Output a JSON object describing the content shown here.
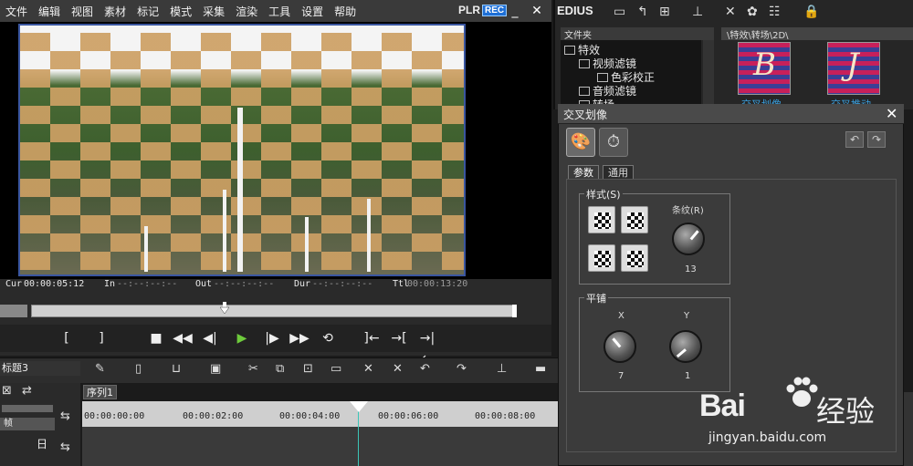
{
  "menubar": {
    "items": [
      "文件",
      "编辑",
      "视图",
      "素材",
      "标记",
      "模式",
      "采集",
      "渲染",
      "工具",
      "设置",
      "帮助"
    ],
    "plr": "PLR",
    "rec": "REC",
    "minimize": "_",
    "close": "✕"
  },
  "timecodes": {
    "cur_label": "Cur",
    "cur_val": "00:00:05:12",
    "in_label": "In",
    "in_val": "--:--:--:--",
    "out_label": "Out",
    "out_val": "--:--:--:--",
    "dur_label": "Dur",
    "dur_val": "--:--:--:--",
    "ttl_label": "Ttl",
    "ttl_val": "00:00:13:20"
  },
  "transport": {
    "mark_in": "[",
    "mark_out": "]",
    "stop": "■",
    "rewind": "◀◀",
    "step_back": "◀|",
    "play": "▶",
    "step_fwd": "|▶",
    "fast_fwd": "▶▶",
    "loop": "⟲",
    "insert": "]←",
    "overwrite": "→[",
    "replace": "→|←"
  },
  "bin": {
    "title": "EDIUS",
    "folder_header": "文件夹",
    "path": "\\特效\\转场\\2D\\",
    "tree": [
      {
        "label": "特效",
        "indent": 0
      },
      {
        "label": "视频滤镜",
        "indent": 1
      },
      {
        "label": "色彩校正",
        "indent": 2
      },
      {
        "label": "音频滤镜",
        "indent": 1
      },
      {
        "label": "转场",
        "indent": 1
      }
    ],
    "thumbnails": [
      {
        "letter": "B",
        "caption": "交叉划像"
      },
      {
        "letter": "J",
        "caption": "交叉推动"
      }
    ]
  },
  "dialog": {
    "title": "交叉划像",
    "close": "✕",
    "tabs": [
      "参数",
      "通用"
    ],
    "style_group": "样式(S)",
    "stripes_label": "条纹(R)",
    "stripes_value": "13",
    "tile_group": "平铺",
    "x_label": "X",
    "x_value": "7",
    "y_label": "Y",
    "y_value": "1"
  },
  "timeline": {
    "sequence_name": "标题3",
    "sequence_tab": "序列1",
    "frame_mode": "帧",
    "track_label": "日",
    "ruler": [
      "00:00:00:00",
      "00:00:02:00",
      "00:00:04:00",
      "00:00:06:00",
      "00:00:08:00"
    ]
  },
  "watermark": {
    "brand": "Bai",
    "brand_cn": "经验",
    "url": "jingyan.baidu.com"
  },
  "colors": {
    "accent_blue": "#1e6fd6",
    "play_green": "#6ecb3c",
    "playhead": "#3bc6b8",
    "thumb_magenta": "#c8205a",
    "thumb_indigo": "#3a3f96"
  }
}
